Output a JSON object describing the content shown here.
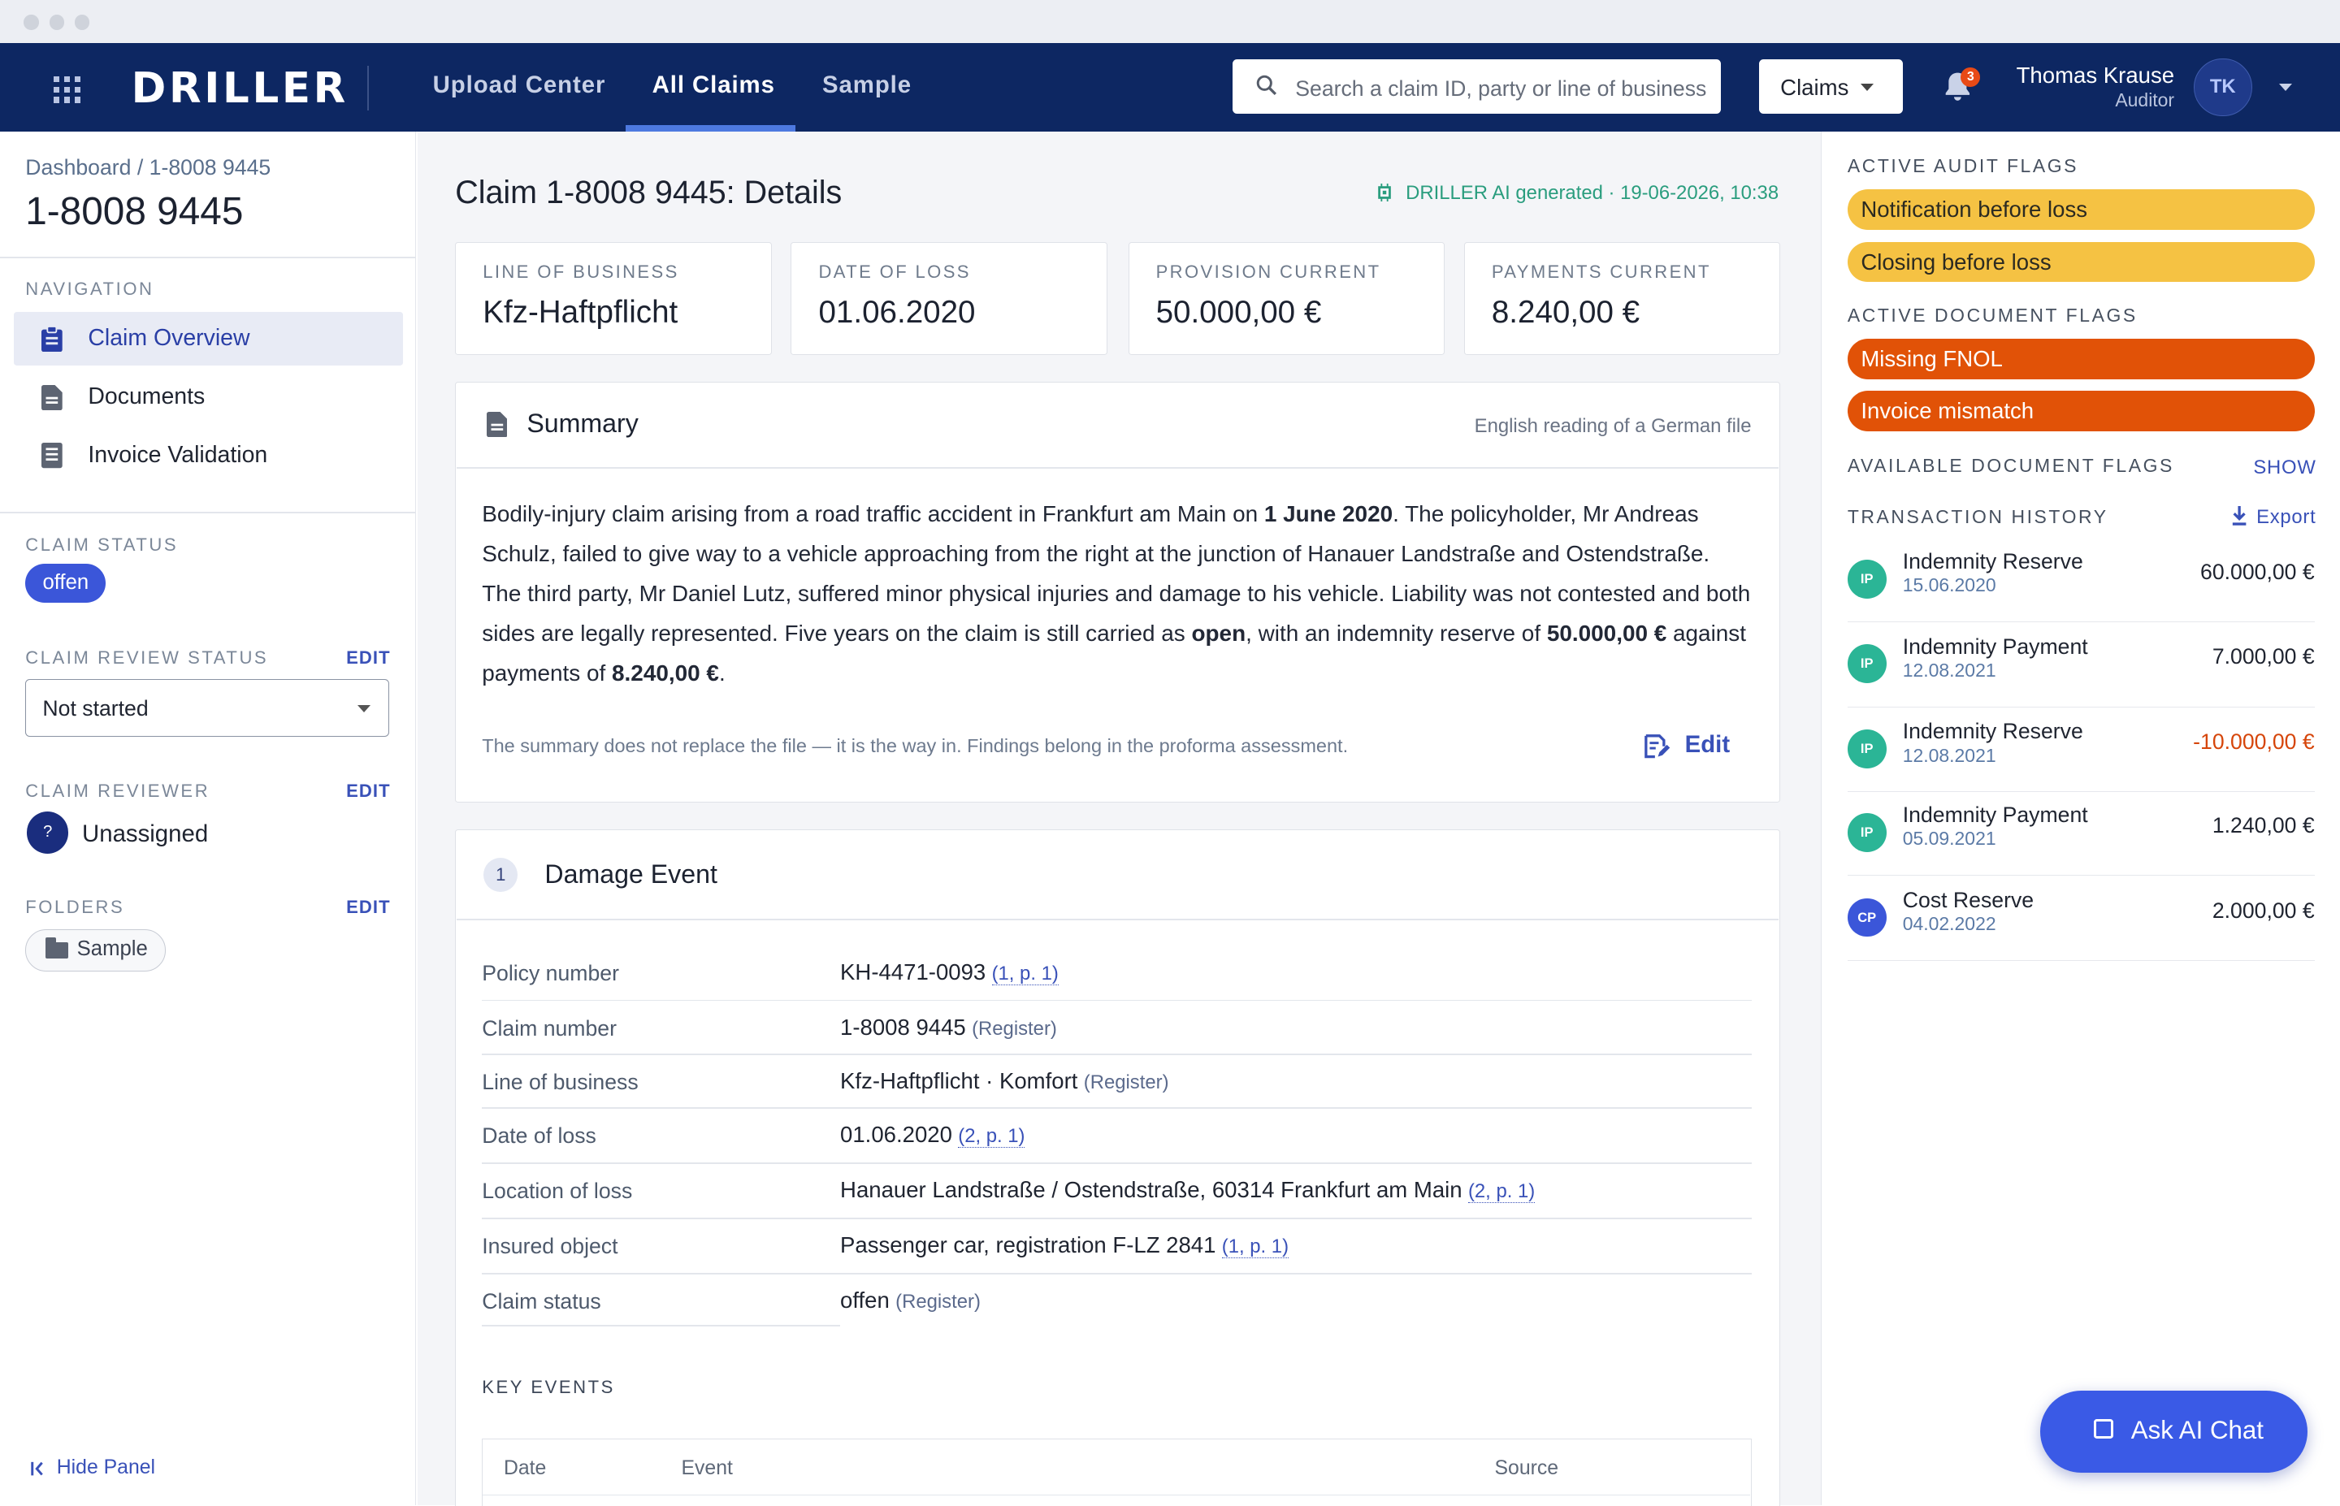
{
  "app": {
    "logo": "DRILLER",
    "nav": [
      "Upload Center",
      "All Claims",
      "Sample"
    ],
    "active_nav": "All Claims",
    "search_placeholder": "Search a claim ID, party or line of business",
    "scope_select": "Claims",
    "notifications_count": "3",
    "user": {
      "name": "Thomas Krause",
      "role": "Auditor",
      "initials": "TK"
    }
  },
  "left": {
    "breadcrumb": "Dashboard / 1-8008 9445",
    "claim_id": "1-8008 9445",
    "navigation_label": "NAVIGATION",
    "nav_items": [
      "Claim Overview",
      "Documents",
      "Invoice Validation"
    ],
    "claim_status_label": "CLAIM STATUS",
    "claim_status": "offen",
    "review_status_label": "CLAIM REVIEW STATUS",
    "review_status": "Not started",
    "reviewer_label": "CLAIM REVIEWER",
    "reviewer_avatar": "?",
    "reviewer": "Unassigned",
    "folders_label": "FOLDERS",
    "folder": "Sample",
    "edit": "EDIT",
    "hide_panel": "Hide Panel"
  },
  "main": {
    "title": "Claim 1-8008 9445: Details",
    "ai_generated": "DRILLER AI generated · 19-06-2026, 10:38",
    "kpis": [
      {
        "label": "LINE OF BUSINESS",
        "value": "Kfz-Haftpflicht"
      },
      {
        "label": "DATE OF LOSS",
        "value": "01.06.2020"
      },
      {
        "label": "PROVISION CURRENT",
        "value": "50.000,00 €"
      },
      {
        "label": "PAYMENTS CURRENT",
        "value": "8.240,00 €"
      }
    ],
    "summary": {
      "title": "Summary",
      "note": "English reading of a German file",
      "p1": "Bodily-injury claim arising from a road traffic accident in Frankfurt am Main on ",
      "b1": "1 June 2020",
      "p2": ". The policyholder, Mr Andreas Schulz, failed to give way to a vehicle approaching from the right at the junction of Hanauer Landstraße and Ostendstraße. The third party, Mr Daniel Lutz, suffered minor physical injuries and damage to his vehicle. Liability was not contested and both sides are legally represented. Five years on the claim is still carried as ",
      "b2": "open",
      "p3": ", with an indemnity reserve of ",
      "b3": "50.000,00 €",
      "p4": " against payments of ",
      "b4": "8.240,00 €",
      "p5": ".",
      "footnote": "The summary does not replace the file — it is the way in. Findings belong in the proforma assessment.",
      "edit": "Edit"
    },
    "damage_event": {
      "step": "1",
      "title": "Damage Event",
      "rows": [
        {
          "key": "Policy number",
          "value": "KH-4471-0093",
          "src": "(1, p. 1)",
          "link": true
        },
        {
          "key": "Claim number",
          "value": "1-8008 9445",
          "src": "(Register)",
          "link": false
        },
        {
          "key": "Line of business",
          "value": "Kfz-Haftpflicht · Komfort",
          "src": "(Register)",
          "link": false
        },
        {
          "key": "Date of loss",
          "value": "01.06.2020",
          "src": "(2, p. 1)",
          "link": true
        },
        {
          "key": "Location of loss",
          "value": "Hanauer Landstraße / Ostendstraße, 60314 Frankfurt am Main",
          "src": "(2, p. 1)",
          "link": true
        },
        {
          "key": "Insured object",
          "value": "Passenger car, registration F-LZ 2841",
          "src": "(1, p. 1)",
          "link": true
        },
        {
          "key": "Claim status",
          "value": "offen",
          "src": "(Register)",
          "link": false
        }
      ],
      "key_events_label": "KEY EVENTS",
      "table_headers": [
        "Date",
        "Event",
        "Source"
      ]
    }
  },
  "right": {
    "audit_flags_label": "ACTIVE AUDIT FLAGS",
    "audit_flags": [
      "Notification before loss",
      "Closing before loss"
    ],
    "doc_flags_label": "ACTIVE DOCUMENT FLAGS",
    "doc_flags": [
      "Missing FNOL",
      "Invoice mismatch"
    ],
    "available_flags_label": "AVAILABLE DOCUMENT FLAGS",
    "show": "SHOW",
    "history_label": "TRANSACTION HISTORY",
    "export": "Export",
    "transactions": [
      {
        "code": "IP",
        "name": "Indemnity Reserve",
        "date": "15.06.2020",
        "amount": "60.000,00 €",
        "color": "#2bb596"
      },
      {
        "code": "IP",
        "name": "Indemnity Payment",
        "date": "12.08.2021",
        "amount": "7.000,00 €",
        "color": "#2bb596"
      },
      {
        "code": "IP",
        "name": "Indemnity Reserve",
        "date": "12.08.2021",
        "amount": "-10.000,00 €",
        "color": "#2bb596"
      },
      {
        "code": "IP",
        "name": "Indemnity Payment",
        "date": "05.09.2021",
        "amount": "1.240,00 €",
        "color": "#2bb596"
      },
      {
        "code": "CP",
        "name": "Cost Reserve",
        "date": "04.02.2022",
        "amount": "2.000,00 €",
        "color": "#3b56d9"
      }
    ]
  },
  "ask_ai": "Ask AI Chat",
  "colors": {
    "navy": "#0d2762",
    "accent": "#3b56d9",
    "flag_yellow": "#f5c243",
    "flag_orange": "#e15207",
    "negative": "#d6460b"
  }
}
